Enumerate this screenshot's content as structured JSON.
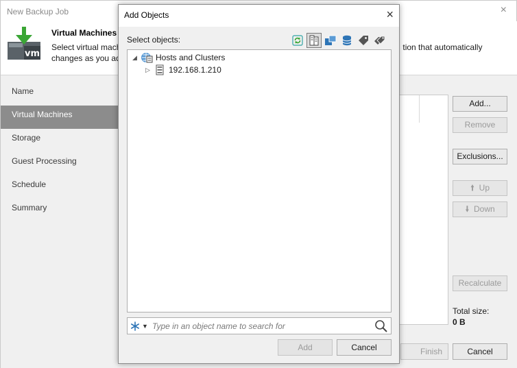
{
  "wizard": {
    "title": "New Backup Job",
    "close_glyph": "×",
    "step_title": "Virtual Machines",
    "description_line1": "Select virtual mach",
    "description_line1_tail": "tion that automatically",
    "description_line2": "changes as you ad",
    "steps": [
      "Name",
      "Virtual Machines",
      "Storage",
      "Guest Processing",
      "Schedule",
      "Summary"
    ],
    "active_step": "Virtual Machines",
    "buttons": {
      "add": "Add...",
      "remove": "Remove",
      "exclusions": "Exclusions...",
      "up": "Up",
      "down": "Down",
      "recalculate": "Recalculate",
      "finish": "Finish",
      "cancel": "Cancel"
    },
    "total_size_label": "Total size:",
    "total_size_value": "0 B"
  },
  "dialog": {
    "title": "Add Objects",
    "close_glyph": "×",
    "select_label": "Select objects:",
    "toolbar_icons": [
      "refresh-icon",
      "hosts-and-clusters-icon",
      "vms-and-templates-icon",
      "datastores-icon",
      "tags-icon",
      "tag-categories-icon"
    ],
    "tree": {
      "root": {
        "label": "Hosts and Clusters",
        "expanded": true,
        "icon": "vcenter-icon"
      },
      "children": [
        {
          "label": "192.168.1.210",
          "expanded": false,
          "icon": "server-icon"
        }
      ]
    },
    "search_placeholder": "Type in an object name to search for",
    "buttons": {
      "add": "Add",
      "cancel": "Cancel"
    }
  },
  "colors": {
    "active_step_bg": "#8c8c8c",
    "accent_green": "#3aa635",
    "accent_blue": "#2e75b6",
    "panel_bg": "#f0f0f0"
  }
}
